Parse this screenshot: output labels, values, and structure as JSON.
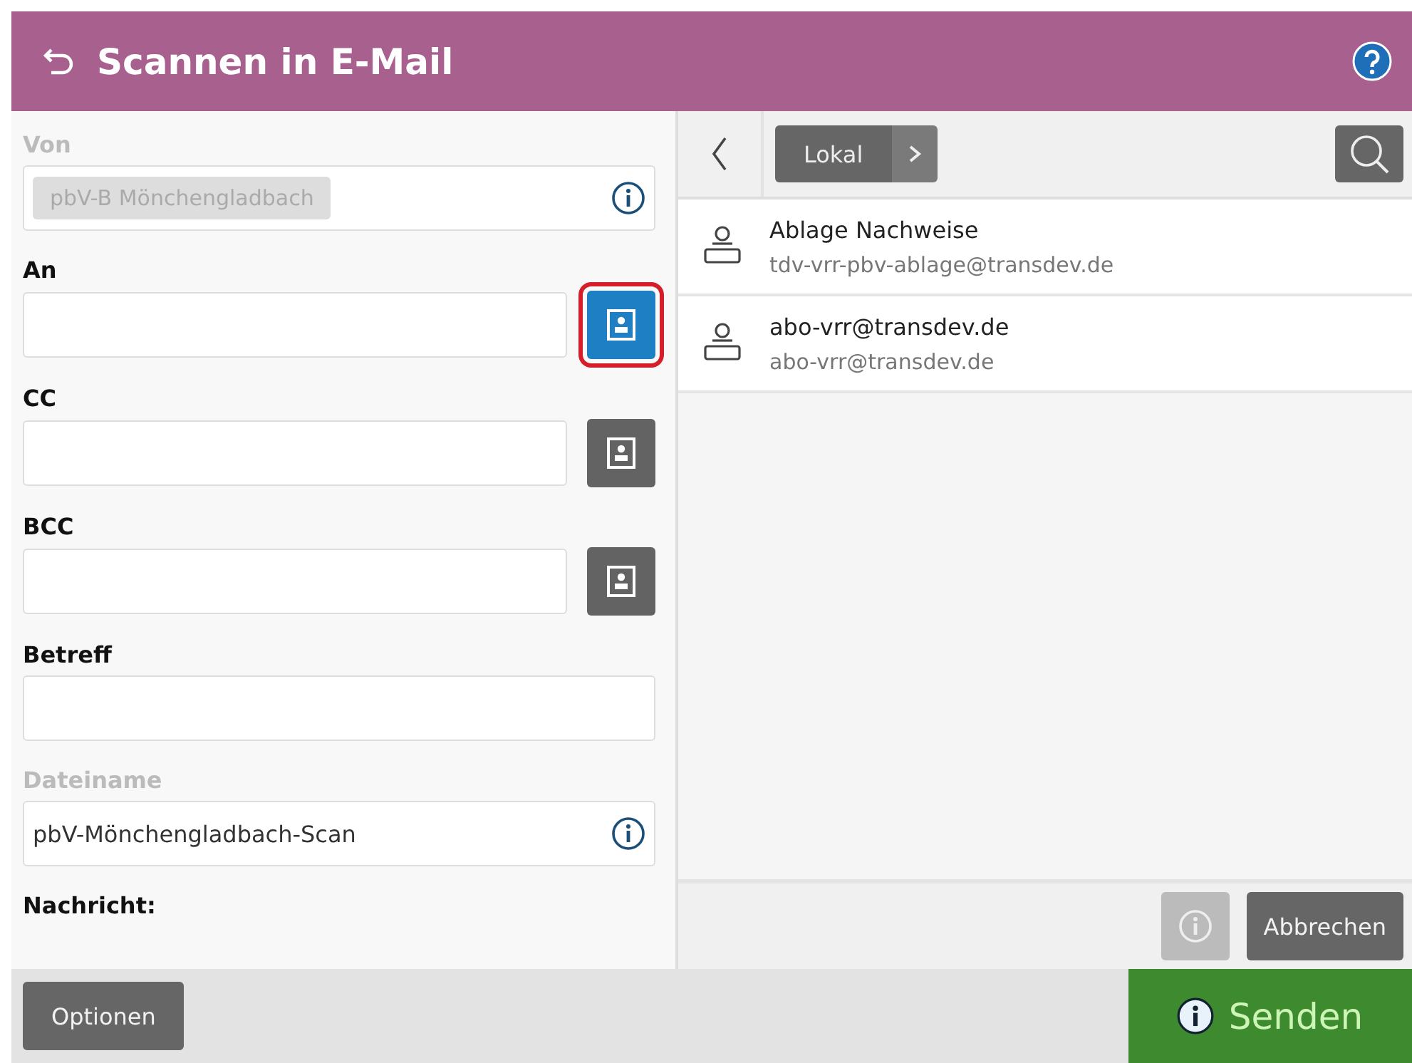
{
  "header": {
    "title": "Scannen in E-Mail"
  },
  "fields": [
    {
      "label": "Von",
      "kind": "chip",
      "disabled": true,
      "value": "pbV-B Mönchengladbach",
      "info": true
    },
    {
      "label": "An",
      "kind": "picker",
      "disabled": false,
      "highlighted": true
    },
    {
      "label": "CC",
      "kind": "picker",
      "disabled": false,
      "highlighted": false
    },
    {
      "label": "BCC",
      "kind": "picker",
      "disabled": false,
      "highlighted": false
    },
    {
      "label": "Betreff",
      "kind": "text",
      "disabled": false
    },
    {
      "label": "Dateiname",
      "kind": "text",
      "disabled": true,
      "value": "pbV-Mönchengladbach-Scan",
      "info": true
    },
    {
      "label": "Nachricht:",
      "kind": "heading",
      "disabled": false
    }
  ],
  "contacts_toolbar": {
    "source": "Lokal"
  },
  "contacts": [
    {
      "name": "Ablage Nachweise",
      "email": "tdv-vrr-pbv-ablage@transdev.de"
    },
    {
      "name": "abo-vrr@transdev.de",
      "email": "abo-vrr@transdev.de"
    }
  ],
  "contacts_footer": {
    "info_disabled": true,
    "cancel": "Abbrechen"
  },
  "bottom_bar": {
    "options": "Optionen",
    "send": "Senden"
  }
}
